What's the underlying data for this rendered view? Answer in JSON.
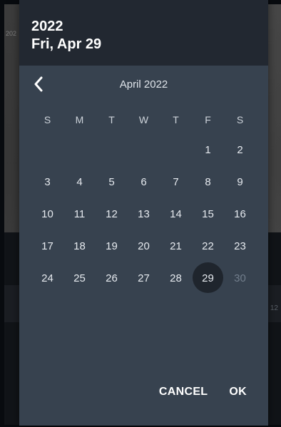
{
  "background": {
    "video_timestamp": "202",
    "bar_number": "12"
  },
  "dialog": {
    "header": {
      "year": "2022",
      "date": "Fri, Apr 29"
    },
    "month_label": "April 2022",
    "weekdays": [
      "S",
      "M",
      "T",
      "W",
      "T",
      "F",
      "S"
    ],
    "weeks": [
      [
        "",
        "",
        "",
        "",
        "",
        "1",
        "2"
      ],
      [
        "3",
        "4",
        "5",
        "6",
        "7",
        "8",
        "9"
      ],
      [
        "10",
        "11",
        "12",
        "13",
        "14",
        "15",
        "16"
      ],
      [
        "17",
        "18",
        "19",
        "20",
        "21",
        "22",
        "23"
      ],
      [
        "24",
        "25",
        "26",
        "27",
        "28",
        "29",
        "30"
      ]
    ],
    "selected_day": "29",
    "disabled_days": [
      "30"
    ],
    "buttons": {
      "cancel": "CANCEL",
      "ok": "OK"
    }
  },
  "colors": {
    "dialog_bg": "#37424f",
    "header_bg": "#222831",
    "selected_bg": "#1f252d"
  }
}
